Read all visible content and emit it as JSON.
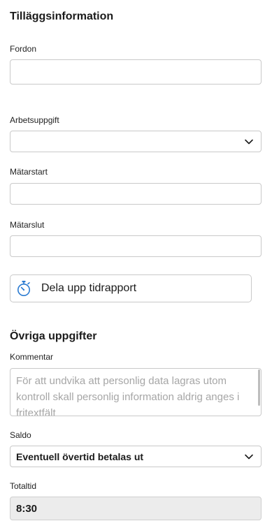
{
  "sections": {
    "additional_info_title": "Tilläggsinformation",
    "other_info_title": "Övriga uppgifter"
  },
  "fields": {
    "vehicle_label": "Fordon",
    "vehicle_value": "",
    "task_label": "Arbetsuppgift",
    "task_value": "",
    "meter_start_label": "Mätarstart",
    "meter_start_value": "",
    "meter_end_label": "Mätarslut",
    "meter_end_value": "",
    "comment_label": "Kommentar",
    "comment_placeholder": "För att undvika att personlig data lagras utom kontroll skall personlig information aldrig anges i fritextfält",
    "balance_label": "Saldo",
    "balance_value": "Eventuell övertid betalas ut",
    "total_time_label": "Totaltid",
    "total_time_value": "8:30"
  },
  "buttons": {
    "split_time_report": "Dela upp tidrapport"
  },
  "icons": {
    "split_button_icon": "stopwatch-icon",
    "dropdown_icon": "chevron-down-icon"
  },
  "colors": {
    "accent_icon": "#2b7bd1",
    "border": "#c9c9c9",
    "readonly_bg": "#ececec"
  }
}
